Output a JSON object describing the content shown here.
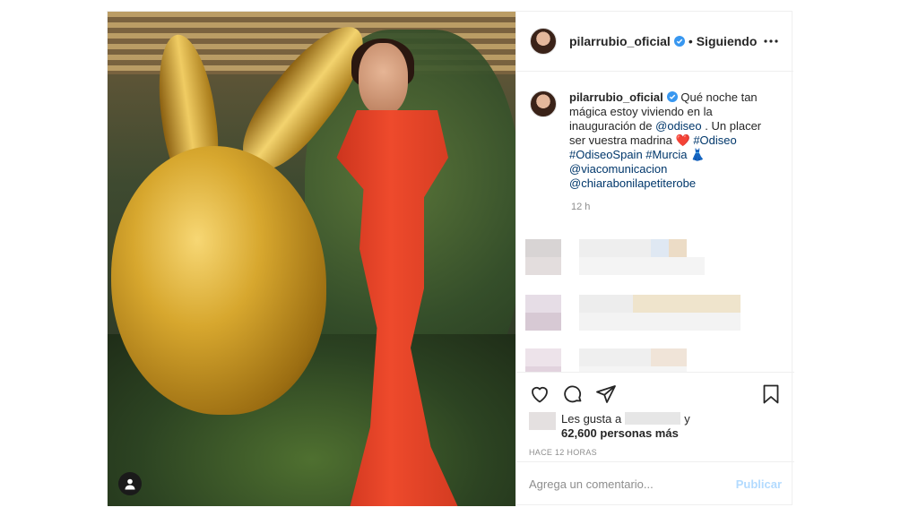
{
  "post": {
    "username": "pilarrubio_oficial",
    "separator": "•",
    "follow_status": "Siguiendo",
    "caption": {
      "username": "pilarrubio_oficial",
      "text_1": " Qué noche tan mágica estoy viviendo en la inauguración de ",
      "mention_1": "@odiseo",
      "text_2": " . Un placer ser vuestra madrina ",
      "heart": "❤️",
      "hashtag_1": "#Odiseo",
      "hashtag_2": "#OdiseoSpain",
      "hashtag_3": "#Murcia",
      "dress_emoji": "👗",
      "mention_2": "@viacomunicacion",
      "mention_3": "@chiarabonilapetiterobe"
    },
    "caption_time": "12 h",
    "likes_prefix": "Les gusta a",
    "likes_and": "y",
    "likes_count": "62,600 personas más",
    "posted_ago": "HACE 12 HORAS",
    "comment_placeholder": "Agrega un comentario...",
    "publish_label": "Publicar"
  },
  "colors": {
    "verified": "#3897f0",
    "link": "#00376b",
    "muted": "#8e8e8e",
    "publish_disabled": "#b3dbff"
  }
}
